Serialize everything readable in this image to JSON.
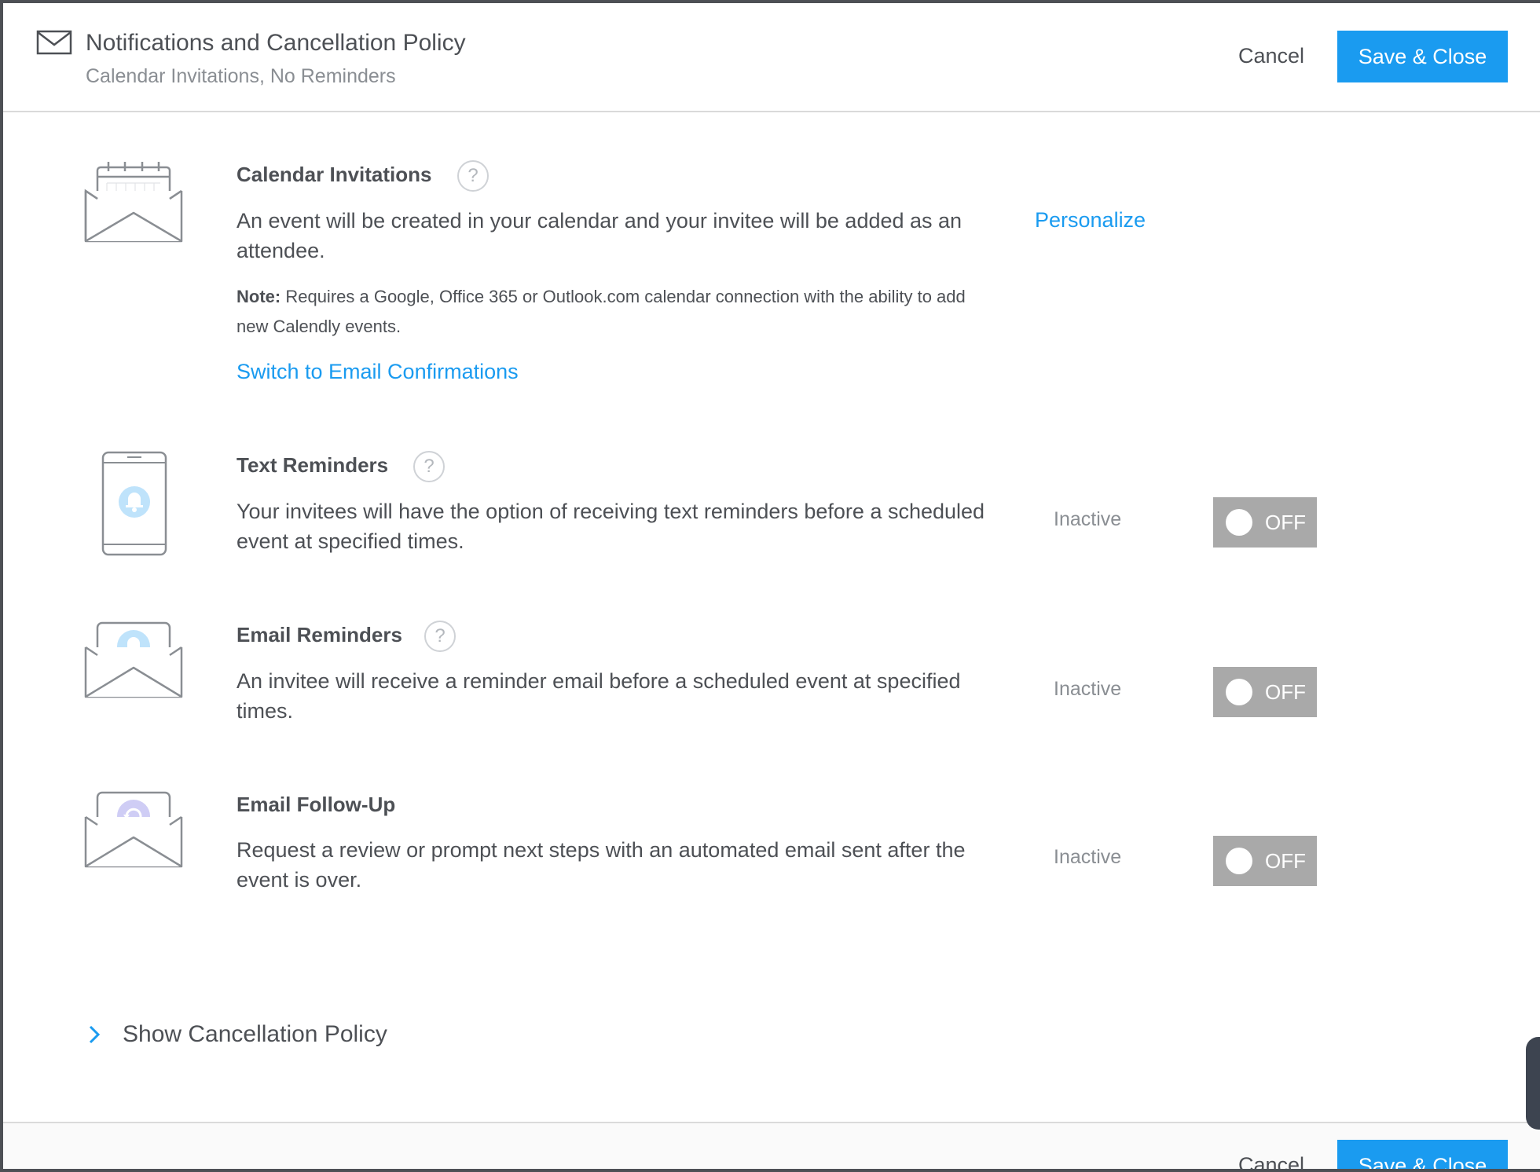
{
  "header": {
    "title": "Notifications and Cancellation Policy",
    "subtitle": "Calendar Invitations, No Reminders",
    "cancel_label": "Cancel",
    "save_label": "Save & Close",
    "icon": "envelope-icon"
  },
  "rows": [
    {
      "title": "Calendar Invitations",
      "help": "?",
      "description": "An event will be created in your calendar and your invitee will be added as an attendee.",
      "note_label": "Note:",
      "note_text": " Requires a Google, Office 365 or Outlook.com calendar connection with the ability to add new Calendly events.",
      "switch_link": "Switch to Email Confirmations",
      "action_link": "Personalize",
      "icon": "calendar-envelope-icon"
    },
    {
      "title": "Text Reminders",
      "help": "?",
      "description": "Your invitees will have the option of receiving text reminders before a scheduled event at specified times.",
      "status": "Inactive",
      "toggle": "OFF",
      "icon": "phone-bell-icon"
    },
    {
      "title": "Email Reminders",
      "help": "?",
      "description": "An invitee will receive a reminder email before a scheduled event at specified times.",
      "status": "Inactive",
      "toggle": "OFF",
      "icon": "envelope-bell-icon"
    },
    {
      "title": "Email Follow-Up",
      "description": "Request a review or prompt next steps with an automated email sent after the event is over.",
      "status": "Inactive",
      "toggle": "OFF",
      "icon": "envelope-refresh-icon"
    }
  ],
  "show_policy_label": "Show Cancellation Policy",
  "footer": {
    "cancel_label": "Cancel",
    "save_label": "Save & Close"
  },
  "colors": {
    "accent": "#1a9bf0",
    "toggle_off": "#a9a9a9",
    "text": "#4d5055",
    "muted": "#8a8e93"
  }
}
